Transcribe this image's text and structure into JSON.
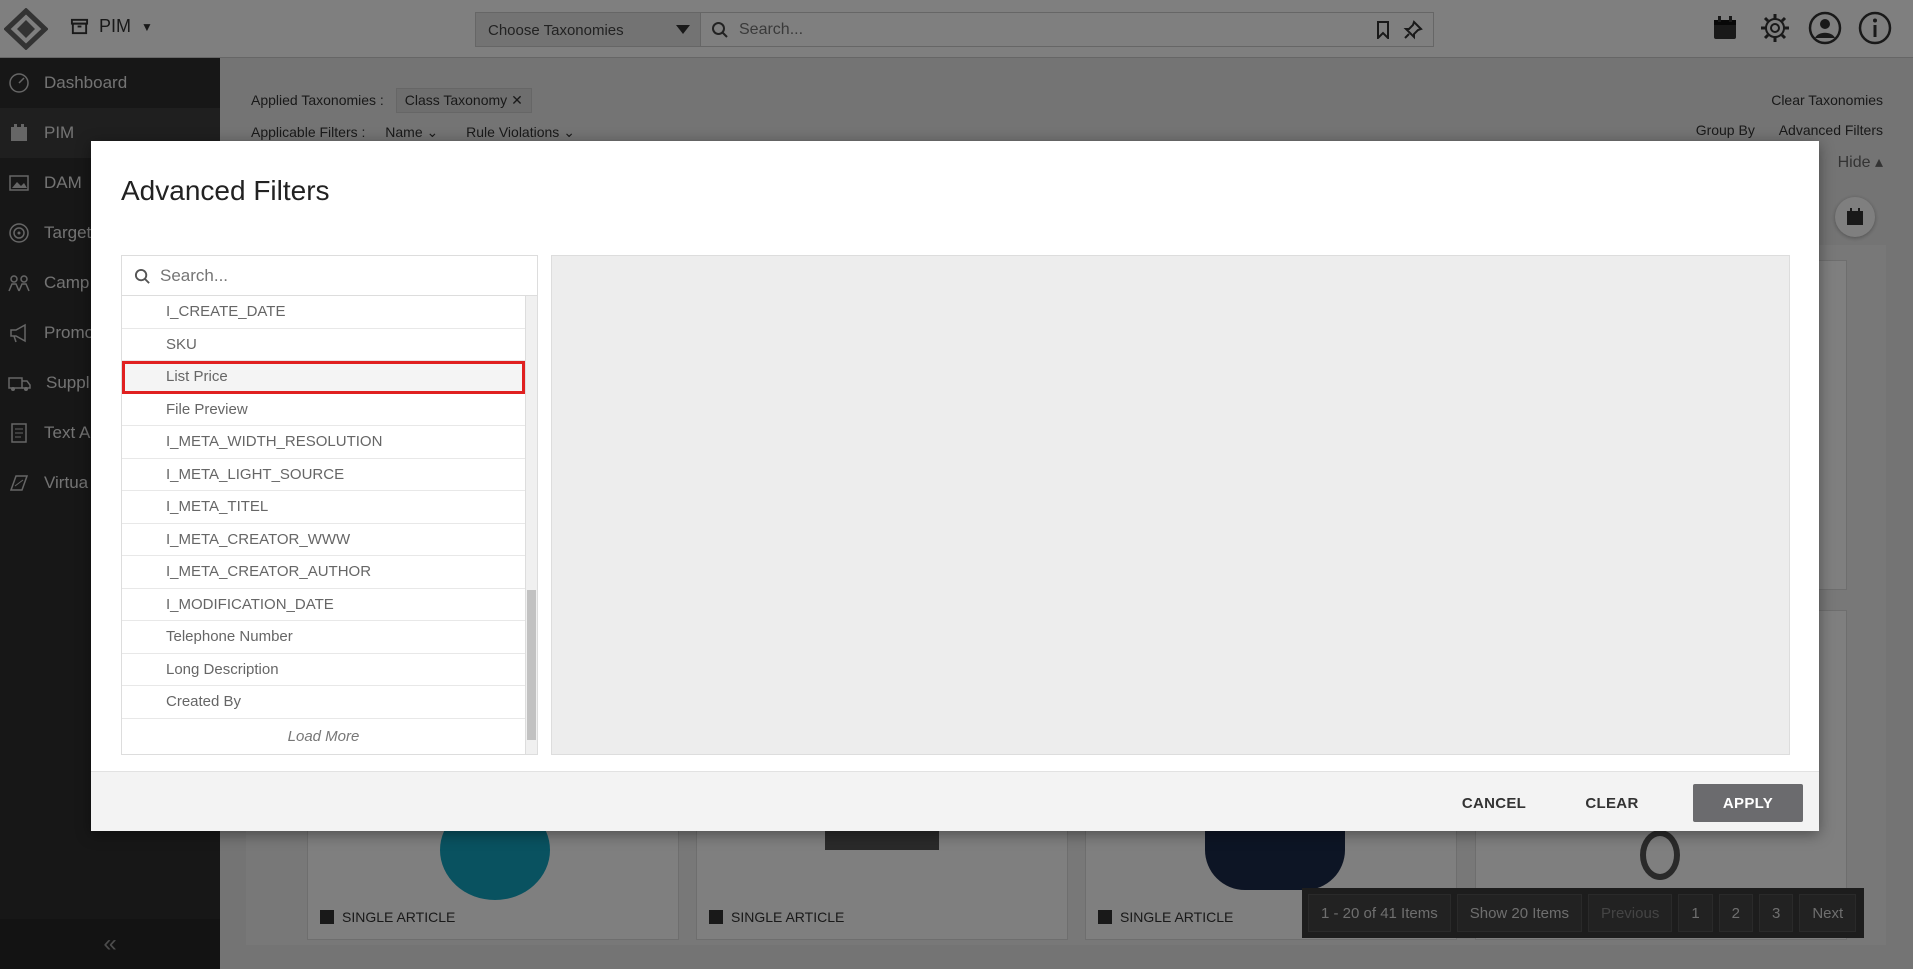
{
  "header": {
    "app_name": "PIM",
    "taxonomy_select": "Choose Taxonomies",
    "search_placeholder": "Search..."
  },
  "sidebar": {
    "items": [
      {
        "label": "Dashboard",
        "icon": "gauge-icon"
      },
      {
        "label": "PIM",
        "icon": "pim-icon"
      },
      {
        "label": "DAM",
        "icon": "image-icon"
      },
      {
        "label": "Target",
        "icon": "target-icon"
      },
      {
        "label": "Camp",
        "icon": "campaign-icon"
      },
      {
        "label": "Promo",
        "icon": "megaphone-icon"
      },
      {
        "label": "Suppl",
        "icon": "truck-icon"
      },
      {
        "label": "Text A",
        "icon": "document-icon"
      },
      {
        "label": "Virtua",
        "icon": "virtual-icon"
      }
    ],
    "collapse_label": "«"
  },
  "background": {
    "applied_taxonomies_label": "Applied Taxonomies :",
    "applied_taxonomy_chip": "Class Taxonomy",
    "applicable_filters_label": "Applicable Filters :",
    "filter_name": "Name",
    "filter_rule_violations": "Rule Violations",
    "clear_taxonomies": "Clear Taxonomies",
    "group_by": "Group By",
    "advanced_filters": "Advanced Filters",
    "hide": "Hide ▴",
    "card_label": "SINGLE ARTICLE"
  },
  "pager": {
    "range": "1 - 20 of 41 Items",
    "show": "Show 20 Items",
    "previous": "Previous",
    "pages": [
      "1",
      "2",
      "3"
    ],
    "next": "Next"
  },
  "modal": {
    "title": "Advanced Filters",
    "search_placeholder": "Search...",
    "attributes": [
      "I_CREATE_DATE",
      "SKU",
      "List Price",
      "File Preview",
      "I_META_WIDTH_RESOLUTION",
      "I_META_LIGHT_SOURCE",
      "I_META_TITEL",
      "I_META_CREATOR_WWW",
      "I_META_CREATOR_AUTHOR",
      "I_MODIFICATION_DATE",
      "Telephone Number",
      "Long Description",
      "Created By"
    ],
    "highlighted_attribute": "List Price",
    "load_more": "Load More",
    "cancel": "CANCEL",
    "clear": "CLEAR",
    "apply": "APPLY"
  }
}
